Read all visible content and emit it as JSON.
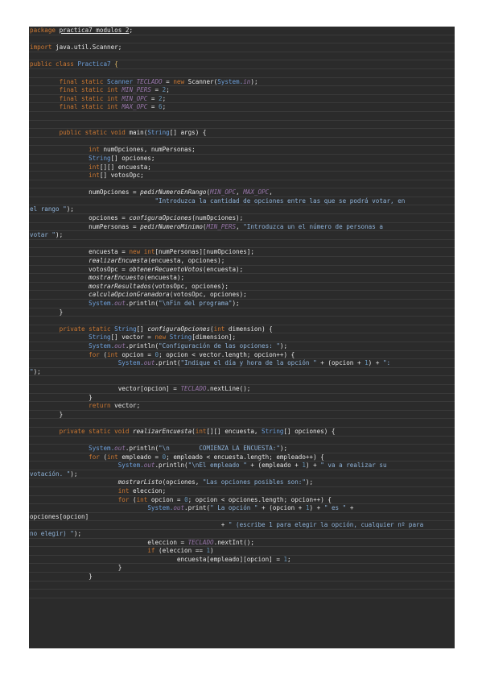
{
  "document": {
    "lines": [
      [
        {
          "t": "package ",
          "c": "kw"
        },
        {
          "t": "practica7_modulos_2",
          "c": "ul"
        },
        {
          "t": ";"
        }
      ],
      [],
      [
        {
          "t": "import ",
          "c": "kw"
        },
        {
          "t": "java.util.Scanner;"
        }
      ],
      [],
      [
        {
          "t": "public ",
          "c": "kw"
        },
        {
          "t": "class ",
          "c": "kw"
        },
        {
          "t": "Practica7 ",
          "c": "ty"
        },
        {
          "t": "{",
          "c": "brace"
        }
      ],
      [],
      [
        {
          "t": "        "
        },
        {
          "t": "final static ",
          "c": "kw"
        },
        {
          "t": "Scanner ",
          "c": "ty"
        },
        {
          "t": "TECLADO",
          "c": "fld"
        },
        {
          "t": " = "
        },
        {
          "t": "new ",
          "c": "kw"
        },
        {
          "t": "Scanner("
        },
        {
          "t": "System.",
          "c": "ty"
        },
        {
          "t": "in",
          "c": "fld"
        },
        {
          "t": ");"
        }
      ],
      [
        {
          "t": "        "
        },
        {
          "t": "final static int ",
          "c": "kw"
        },
        {
          "t": "MIN_PERS",
          "c": "fld"
        },
        {
          "t": " = "
        },
        {
          "t": "2",
          "c": "nm"
        },
        {
          "t": ";"
        }
      ],
      [
        {
          "t": "        "
        },
        {
          "t": "final static int ",
          "c": "kw"
        },
        {
          "t": "MIN_OPC",
          "c": "fld"
        },
        {
          "t": " = "
        },
        {
          "t": "2",
          "c": "nm"
        },
        {
          "t": ";"
        }
      ],
      [
        {
          "t": "        "
        },
        {
          "t": "final static int ",
          "c": "kw"
        },
        {
          "t": "MAX_OPC",
          "c": "fld"
        },
        {
          "t": " = "
        },
        {
          "t": "6",
          "c": "nm"
        },
        {
          "t": ";"
        }
      ],
      [],
      [],
      [
        {
          "t": "        "
        },
        {
          "t": "public static void ",
          "c": "kw"
        },
        {
          "t": "main("
        },
        {
          "t": "String",
          "c": "ty"
        },
        {
          "t": "[] args) {"
        }
      ],
      [],
      [
        {
          "t": "                "
        },
        {
          "t": "int ",
          "c": "kw"
        },
        {
          "t": "numOpciones, numPersonas;"
        }
      ],
      [
        {
          "t": "                "
        },
        {
          "t": "String",
          "c": "ty"
        },
        {
          "t": "[] opciones;"
        }
      ],
      [
        {
          "t": "                "
        },
        {
          "t": "int",
          "c": "kw"
        },
        {
          "t": "[][] encuesta;"
        }
      ],
      [
        {
          "t": "                "
        },
        {
          "t": "int",
          "c": "kw"
        },
        {
          "t": "[] votosOpc;"
        }
      ],
      [],
      [
        {
          "t": "                "
        },
        {
          "t": "numOpciones = "
        },
        {
          "t": "pedirNumeroEnRango",
          "c": "it"
        },
        {
          "t": "("
        },
        {
          "t": "MIN_OPC",
          "c": "fld"
        },
        {
          "t": ", "
        },
        {
          "t": "MAX_OPC",
          "c": "fld"
        },
        {
          "t": ","
        }
      ],
      [
        {
          "t": "                                  "
        },
        {
          "t": "\"Introduzca la cantidad de opciones entre las que se podrá votar, en",
          "c": "st"
        }
      ],
      [
        {
          "t": "el rango \"",
          "c": "st"
        },
        {
          "t": ");"
        }
      ],
      [
        {
          "t": "                "
        },
        {
          "t": "opciones = "
        },
        {
          "t": "configuraOpciones",
          "c": "it"
        },
        {
          "t": "(numOpciones);"
        }
      ],
      [
        {
          "t": "                "
        },
        {
          "t": "numPersonas = "
        },
        {
          "t": "pedirNumeroMinimo",
          "c": "it"
        },
        {
          "t": "("
        },
        {
          "t": "MIN_PERS",
          "c": "fld"
        },
        {
          "t": ", "
        },
        {
          "t": "\"Introduzca un el número de personas a",
          "c": "st"
        }
      ],
      [
        {
          "t": "votar \"",
          "c": "st"
        },
        {
          "t": ");"
        }
      ],
      [],
      [
        {
          "t": "                "
        },
        {
          "t": "encuesta = "
        },
        {
          "t": "new int",
          "c": "kw"
        },
        {
          "t": "[numPersonas][numOpciones];"
        }
      ],
      [
        {
          "t": "                "
        },
        {
          "t": "realizarEncuesta",
          "c": "it"
        },
        {
          "t": "(encuesta, opciones);"
        }
      ],
      [
        {
          "t": "                "
        },
        {
          "t": "votosOpc = "
        },
        {
          "t": "obtenerRecuentoVotos",
          "c": "it"
        },
        {
          "t": "(encuesta);"
        }
      ],
      [
        {
          "t": "                "
        },
        {
          "t": "mostrarEncuesto",
          "c": "it"
        },
        {
          "t": "(encuesta);"
        }
      ],
      [
        {
          "t": "                "
        },
        {
          "t": "mostrarResultados",
          "c": "it"
        },
        {
          "t": "(votosOpc, opciones);"
        }
      ],
      [
        {
          "t": "                "
        },
        {
          "t": "calculaOpcionGranadora",
          "c": "it"
        },
        {
          "t": "(votosOpc, opciones);"
        }
      ],
      [
        {
          "t": "                "
        },
        {
          "t": "System.",
          "c": "ty"
        },
        {
          "t": "out",
          "c": "fld"
        },
        {
          "t": ".println("
        },
        {
          "t": "\"\\nFin del programa\"",
          "c": "st"
        },
        {
          "t": ");"
        }
      ],
      [
        {
          "t": "        }"
        }
      ],
      [],
      [
        {
          "t": "        "
        },
        {
          "t": "private static ",
          "c": "kw"
        },
        {
          "t": "String",
          "c": "ty"
        },
        {
          "t": "[] "
        },
        {
          "t": "configuraOpciones",
          "c": "it"
        },
        {
          "t": "("
        },
        {
          "t": "int ",
          "c": "kw"
        },
        {
          "t": "dimension) {"
        }
      ],
      [
        {
          "t": "                "
        },
        {
          "t": "String",
          "c": "ty"
        },
        {
          "t": "[] vector = "
        },
        {
          "t": "new ",
          "c": "kw"
        },
        {
          "t": "String",
          "c": "ty"
        },
        {
          "t": "[dimension];"
        }
      ],
      [
        {
          "t": "                "
        },
        {
          "t": "System.",
          "c": "ty"
        },
        {
          "t": "out",
          "c": "fld"
        },
        {
          "t": ".println("
        },
        {
          "t": "\"Configuración de las opciones: \"",
          "c": "st"
        },
        {
          "t": ");"
        }
      ],
      [
        {
          "t": "                "
        },
        {
          "t": "for ",
          "c": "kw"
        },
        {
          "t": "("
        },
        {
          "t": "int ",
          "c": "kw"
        },
        {
          "t": "opcion = "
        },
        {
          "t": "0",
          "c": "nm"
        },
        {
          "t": "; opcion < vector.length; opcion++) {"
        }
      ],
      [
        {
          "t": "                        "
        },
        {
          "t": "System.",
          "c": "ty"
        },
        {
          "t": "out",
          "c": "fld"
        },
        {
          "t": ".print("
        },
        {
          "t": "\"Indique el día y hora de la opción \"",
          "c": "st"
        },
        {
          "t": " + (opcion + "
        },
        {
          "t": "1",
          "c": "nm"
        },
        {
          "t": ") + "
        },
        {
          "t": "\":",
          "c": "st"
        }
      ],
      [
        {
          "t": "\"",
          "c": "st"
        },
        {
          "t": ");"
        }
      ],
      [],
      [
        {
          "t": "                        "
        },
        {
          "t": "vector[opcion] = "
        },
        {
          "t": "TECLADO",
          "c": "fld"
        },
        {
          "t": ".nextLine();"
        }
      ],
      [
        {
          "t": "                }"
        }
      ],
      [
        {
          "t": "                "
        },
        {
          "t": "return ",
          "c": "kw"
        },
        {
          "t": "vector;"
        }
      ],
      [
        {
          "t": "        }"
        }
      ],
      [],
      [
        {
          "t": "        "
        },
        {
          "t": "private static void ",
          "c": "kw"
        },
        {
          "t": "realizarEncuesta",
          "c": "it"
        },
        {
          "t": "("
        },
        {
          "t": "int",
          "c": "kw"
        },
        {
          "t": "[][] encuesta, "
        },
        {
          "t": "String",
          "c": "ty"
        },
        {
          "t": "[] opciones) {"
        }
      ],
      [],
      [
        {
          "t": "                "
        },
        {
          "t": "System.",
          "c": "ty"
        },
        {
          "t": "out",
          "c": "fld"
        },
        {
          "t": ".println("
        },
        {
          "t": "\"\\n        COMIENZA LA ENCUESTA:\"",
          "c": "st"
        },
        {
          "t": ");"
        }
      ],
      [
        {
          "t": "                "
        },
        {
          "t": "for ",
          "c": "kw"
        },
        {
          "t": "("
        },
        {
          "t": "int ",
          "c": "kw"
        },
        {
          "t": "empleado = "
        },
        {
          "t": "0",
          "c": "nm"
        },
        {
          "t": "; empleado < encuesta.length; empleado++) {"
        }
      ],
      [
        {
          "t": "                        "
        },
        {
          "t": "System.",
          "c": "ty"
        },
        {
          "t": "out",
          "c": "fld"
        },
        {
          "t": ".println("
        },
        {
          "t": "\"\\nEl empleado \"",
          "c": "st"
        },
        {
          "t": " + (empleado + "
        },
        {
          "t": "1",
          "c": "nm"
        },
        {
          "t": ") + "
        },
        {
          "t": "\" va a realizar su",
          "c": "st"
        }
      ],
      [
        {
          "t": "votación. \"",
          "c": "st"
        },
        {
          "t": ");"
        }
      ],
      [
        {
          "t": "                        "
        },
        {
          "t": "mostrarListo",
          "c": "it"
        },
        {
          "t": "(opciones, "
        },
        {
          "t": "\"Las opciones posibles son:\"",
          "c": "st"
        },
        {
          "t": ");"
        }
      ],
      [
        {
          "t": "                        "
        },
        {
          "t": "int ",
          "c": "kw"
        },
        {
          "t": "eleccion;"
        }
      ],
      [
        {
          "t": "                        "
        },
        {
          "t": "for ",
          "c": "kw"
        },
        {
          "t": "("
        },
        {
          "t": "int ",
          "c": "kw"
        },
        {
          "t": "opcion = "
        },
        {
          "t": "0",
          "c": "nm"
        },
        {
          "t": "; opcion < opciones.length; opcion++) {"
        }
      ],
      [
        {
          "t": "                                "
        },
        {
          "t": "System.",
          "c": "ty"
        },
        {
          "t": "out",
          "c": "fld"
        },
        {
          "t": ".print("
        },
        {
          "t": "\" La opción \"",
          "c": "st"
        },
        {
          "t": " + (opcion + "
        },
        {
          "t": "1",
          "c": "nm"
        },
        {
          "t": ") + "
        },
        {
          "t": "\" es \"",
          "c": "st"
        },
        {
          "t": " +"
        }
      ],
      [
        {
          "t": "opciones[opcion]"
        }
      ],
      [
        {
          "t": "                                                    + "
        },
        {
          "t": "\" (escribe 1 para elegir la opción, cualquier nº para",
          "c": "st"
        }
      ],
      [
        {
          "t": "no elegir) \"",
          "c": "st"
        },
        {
          "t": ");"
        }
      ],
      [
        {
          "t": "                                "
        },
        {
          "t": "eleccion = "
        },
        {
          "t": "TECLADO",
          "c": "fld"
        },
        {
          "t": ".nextInt();"
        }
      ],
      [
        {
          "t": "                                "
        },
        {
          "t": "if ",
          "c": "kw"
        },
        {
          "t": "(eleccion == "
        },
        {
          "t": "1",
          "c": "nm"
        },
        {
          "t": ")"
        }
      ],
      [
        {
          "t": "                                        "
        },
        {
          "t": "encuesta[empleado][opcion] = "
        },
        {
          "t": "1",
          "c": "nm"
        },
        {
          "t": ";"
        }
      ],
      [
        {
          "t": "                        }"
        }
      ],
      [
        {
          "t": "                }"
        }
      ],
      [],
      []
    ]
  }
}
